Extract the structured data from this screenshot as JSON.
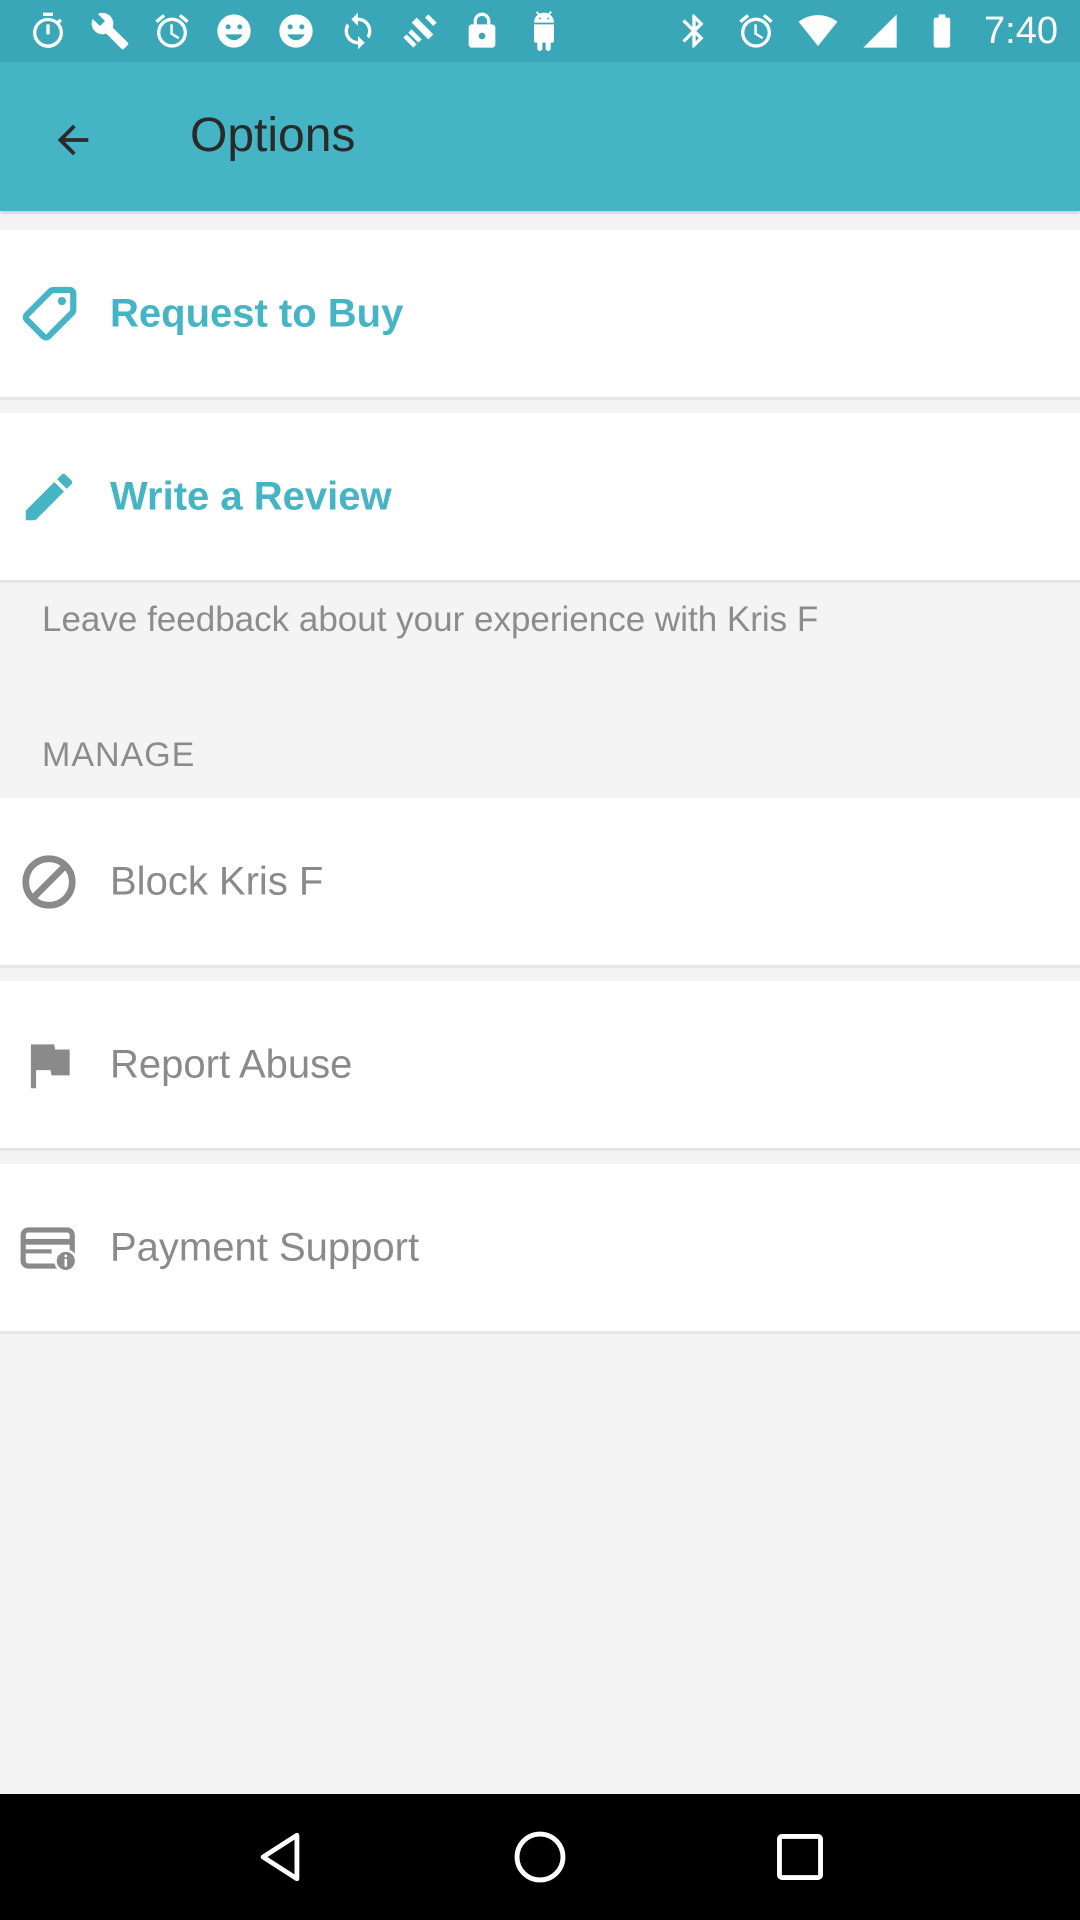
{
  "status_bar": {
    "time": "7:40",
    "left_icons": [
      "stopwatch-icon",
      "wrench-icon",
      "alarm-icon",
      "smiley-icon",
      "smiley-icon",
      "sync-icon",
      "fake-gps-icon",
      "lock-icon",
      "android-icon"
    ],
    "right_icons": [
      "bluetooth-icon",
      "alarm-icon",
      "wifi-icon",
      "signal-icon",
      "battery-icon"
    ]
  },
  "app_bar": {
    "title": "Options",
    "back_icon": "arrow-back-icon"
  },
  "actions": [
    {
      "label": "Request to Buy",
      "icon": "tag-icon"
    },
    {
      "label": "Write a Review",
      "icon": "pencil-icon"
    }
  ],
  "review_helper": "Leave feedback about your experience with Kris F",
  "manage": {
    "header": "MANAGE",
    "items": [
      {
        "label": "Block Kris F",
        "icon": "block-icon"
      },
      {
        "label": "Report Abuse",
        "icon": "flag-icon"
      },
      {
        "label": "Payment Support",
        "icon": "card-info-icon"
      }
    ]
  },
  "colors": {
    "status_bar": "#3aa7b8",
    "app_bar": "#45b5c5",
    "accent": "#45b5c5",
    "muted_text": "#8a8a8a",
    "background": "#f4f4f4"
  },
  "nav_bar": [
    "back-nav-icon",
    "home-nav-icon",
    "recents-nav-icon"
  ]
}
